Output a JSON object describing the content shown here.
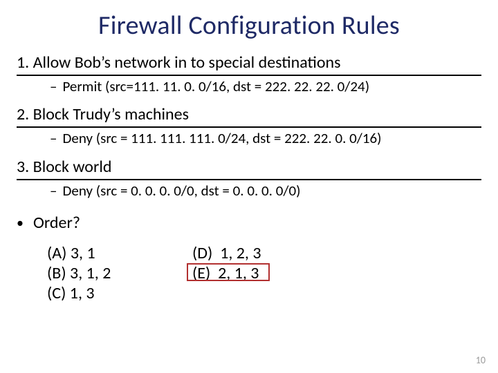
{
  "title": "Firewall Configuration Rules",
  "rules": [
    {
      "num": "1.",
      "heading": "Allow Bob’s network in to special destinations",
      "detail": "Permit (src=111. 11. 0. 0/16, dst = 222. 22. 22. 0/24)"
    },
    {
      "num": "2.",
      "heading": "Block Trudy’s machines",
      "detail": "Deny (src = 111. 111. 111. 0/24, dst = 222. 22. 0. 0/16)"
    },
    {
      "num": "3.",
      "heading": "Block world",
      "detail": "Deny (src = 0. 0. 0. 0/0, dst = 0. 0. 0. 0/0)"
    }
  ],
  "question": "Order?",
  "options_left": [
    {
      "label": "(A)",
      "text": "3, 1"
    },
    {
      "label": "(B)",
      "text": "3, 1, 2"
    },
    {
      "label": "(C)",
      "text": "1, 3"
    }
  ],
  "options_right": [
    {
      "label": "(D)",
      "text": "1, 2, 3"
    },
    {
      "label": "(E)",
      "text": "2, 1, 3"
    }
  ],
  "page_number": "10"
}
